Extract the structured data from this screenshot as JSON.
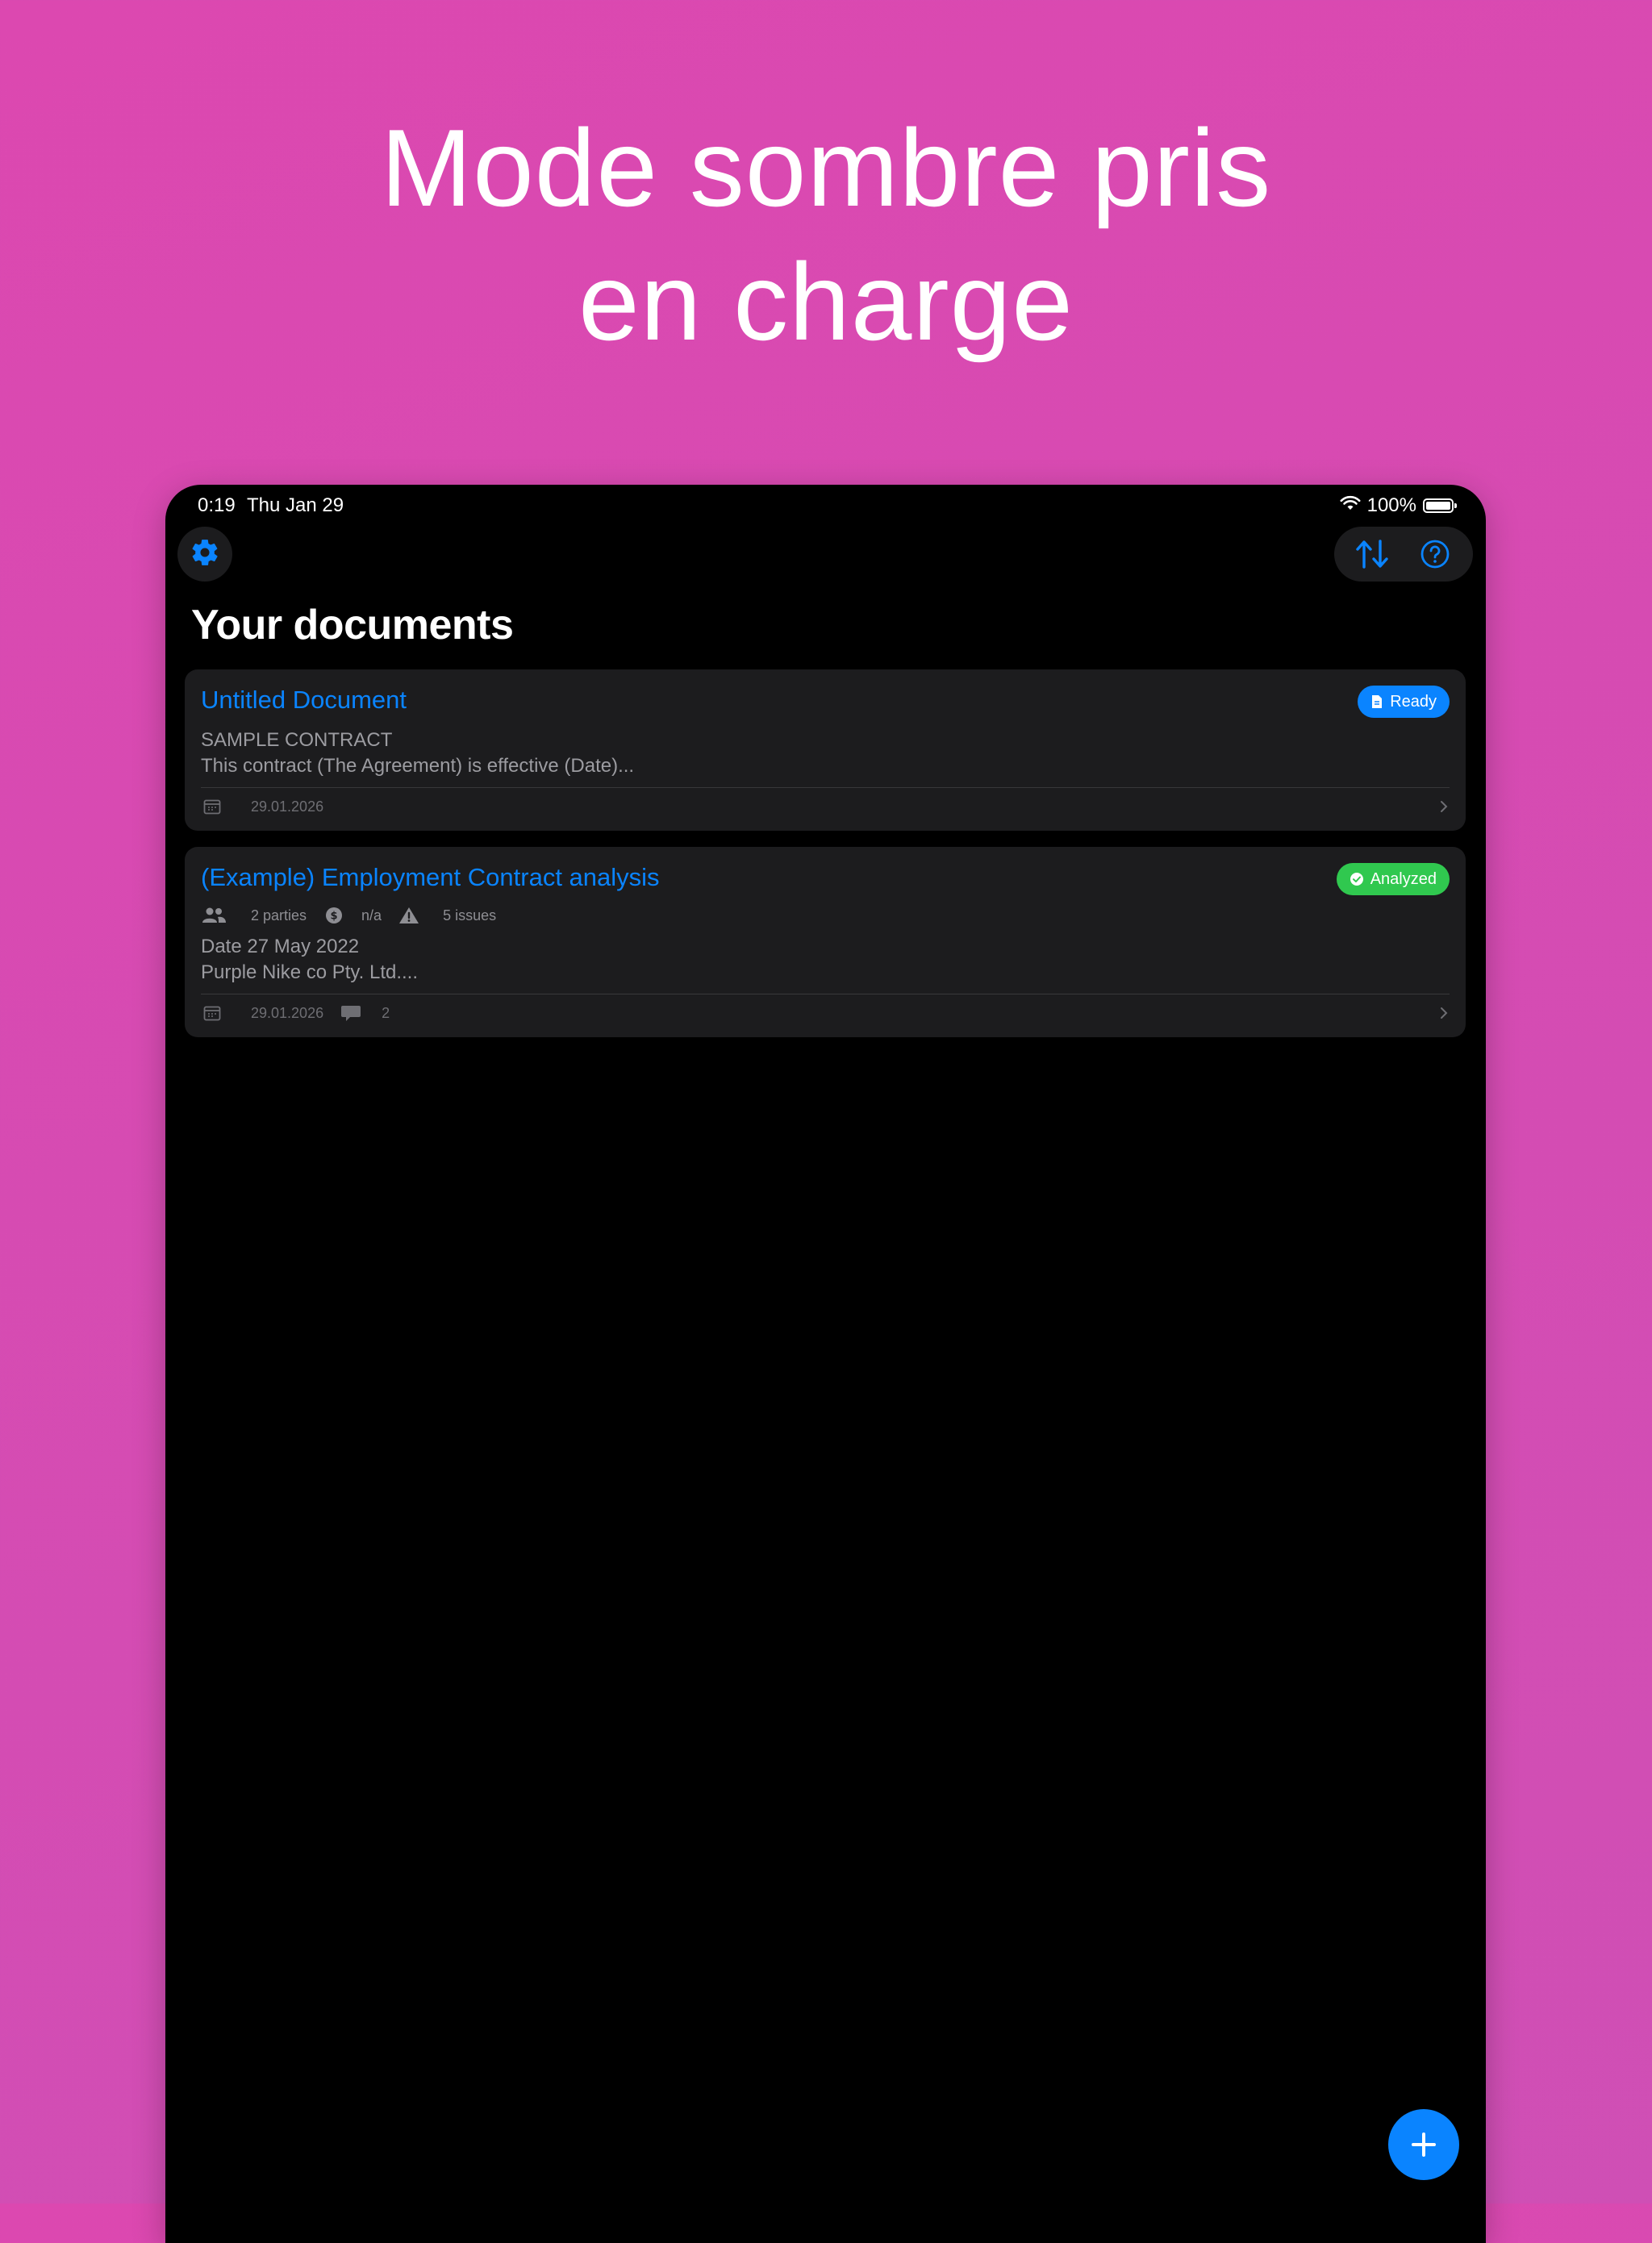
{
  "headline": "Mode sombre pris en charge",
  "status_bar": {
    "time": "0:19",
    "date": "Thu Jan 29",
    "battery": "100%"
  },
  "toolbar": {
    "settings_icon": "gear-icon",
    "sort_icon": "sort-arrows-icon",
    "help_icon": "question-circle-icon"
  },
  "page_title": "Your documents",
  "documents": [
    {
      "title": "Untitled Document",
      "status": "Ready",
      "status_color": "#0a84ff",
      "preview_line1": "SAMPLE CONTRACT",
      "preview_line2": "This contract (The Agreement) is effective (Date)...",
      "date": "29.01.2026"
    },
    {
      "title": "(Example) Employment Contract analysis",
      "status": "Analyzed",
      "status_color": "#30c84f",
      "parties": "2 parties",
      "value": "n/a",
      "issues": "5 issues",
      "preview_line1": "Date 27 May 2022",
      "preview_line2": "Purple Nike co Pty. Ltd....",
      "date": "29.01.2026",
      "comments": "2"
    }
  ],
  "accent_color": "#0a84ff"
}
